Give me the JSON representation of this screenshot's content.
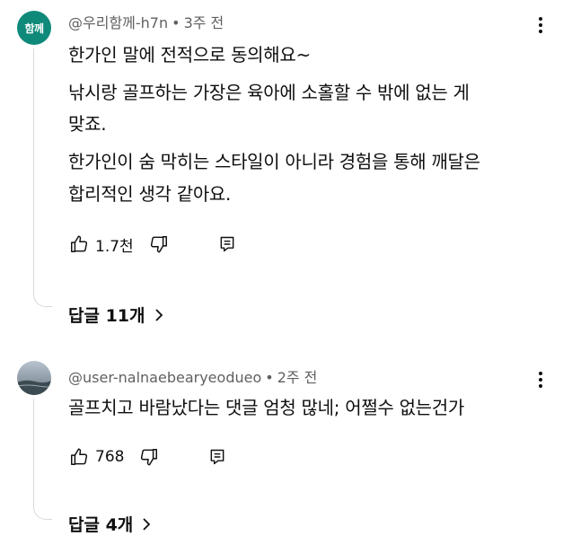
{
  "comments": [
    {
      "avatar_text": "함께",
      "author": "@우리함께-h7n",
      "time": "3주 전",
      "lines": [
        "한가인 말에 전적으로 동의해요~",
        "낚시랑 골프하는 가장은 육아에 소홀할 수 밖에 없는 게",
        "맞죠.",
        "한가인이 숨 막히는 스타일이 아니라 경험을 통해 깨달은",
        "합리적인 생각 같아요."
      ],
      "likes": "1.7천",
      "replies_label": "답글 11개"
    },
    {
      "author": "@user-nalnaebearyeodueo",
      "time": "2주 전",
      "lines": [
        "골프치고 바람났다는 댓글 엄청 많네; 어쩔수 없는건가"
      ],
      "likes": "768",
      "replies_label": "답글 4개"
    }
  ],
  "separator": "•",
  "icons": {
    "like": "thumb-up-icon",
    "dislike": "thumb-down-icon",
    "reply": "reply-icon",
    "more": "more-vert-icon",
    "chevron": "chevron-right-icon"
  }
}
